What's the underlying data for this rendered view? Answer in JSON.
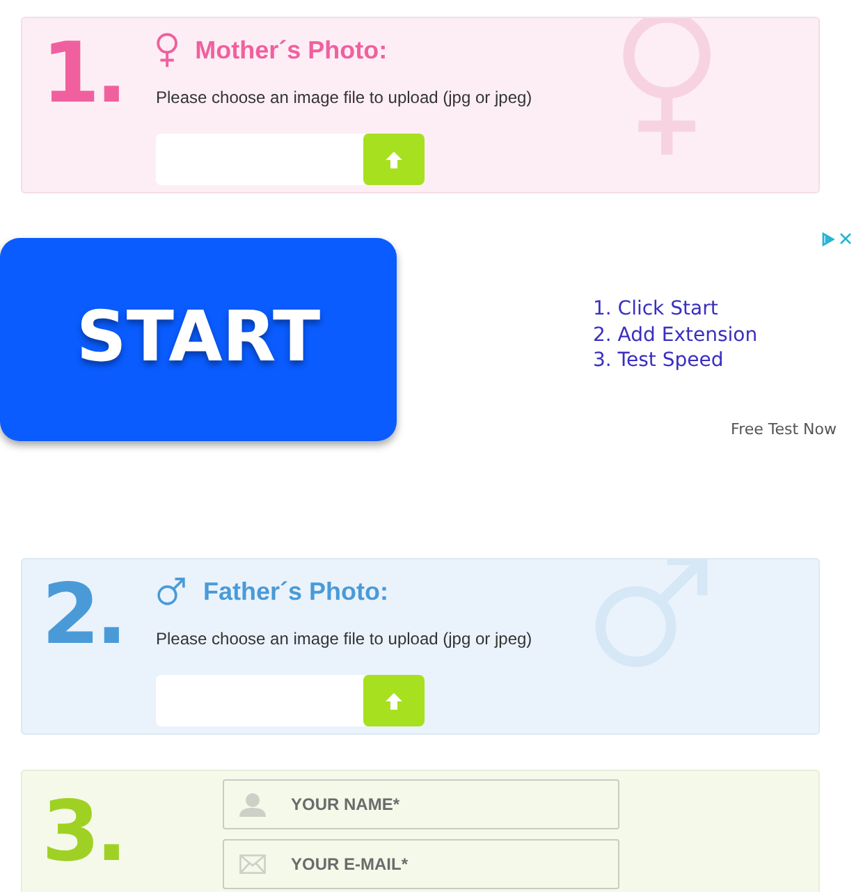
{
  "photo_sections": [
    {
      "kind": "female",
      "number": "1.",
      "title": "Mother´s Photo:",
      "hint": "Please choose an image file to upload (jpg or jpeg)"
    },
    {
      "kind": "male",
      "number": "2.",
      "title": "Father´s Photo:",
      "hint": "Please choose an image file to upload (jpg or jpeg)"
    }
  ],
  "ad": {
    "button": "START",
    "steps": [
      "1. Click Start",
      "2. Add Extension",
      "3. Test Speed"
    ],
    "cta": "Free Test Now"
  },
  "contact": {
    "number": "3.",
    "fields": [
      {
        "kind": "name",
        "placeholder": "YOUR NAME*"
      },
      {
        "kind": "email",
        "placeholder": "YOUR E-MAIL*"
      }
    ]
  }
}
